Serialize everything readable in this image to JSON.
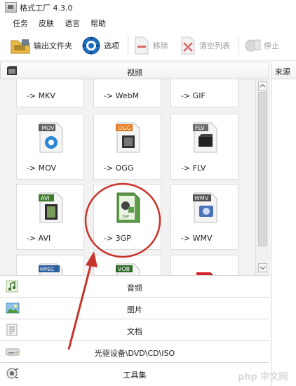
{
  "window": {
    "title": "格式工厂 4.3.0"
  },
  "menu": [
    "任务",
    "皮肤",
    "语言",
    "帮助"
  ],
  "toolbar": {
    "output_folder": "输出文件夹",
    "options": "选项",
    "remove": "移除",
    "clear_list": "清空列表",
    "stop": "停止"
  },
  "category_header": "视频",
  "right_pane_header": "来源",
  "tiles": [
    {
      "label": "-> MKV",
      "badge": ""
    },
    {
      "label": "-> WebM",
      "badge": ""
    },
    {
      "label": "-> GIF",
      "badge": ""
    },
    {
      "label": "-> MOV",
      "badge": "MOV"
    },
    {
      "label": "-> OGG",
      "badge": "OGG"
    },
    {
      "label": "-> FLV",
      "badge": "FLV"
    },
    {
      "label": "-> AVI",
      "badge": "AVI"
    },
    {
      "label": "-> 3GP",
      "badge": "3GP"
    },
    {
      "label": "-> WMV",
      "badge": "WMV"
    },
    {
      "label": "",
      "badge": "MPEG"
    },
    {
      "label": "",
      "badge": "VOB"
    },
    {
      "label": "",
      "badge": ""
    }
  ],
  "categories": [
    "音频",
    "图片",
    "文档",
    "光驱设备\\DVD\\CD\\ISO",
    "工具集"
  ],
  "watermark": "php 中文网",
  "colors": {
    "annotation_red": "#c8332a",
    "accent_blue": "#1e6fc3"
  }
}
